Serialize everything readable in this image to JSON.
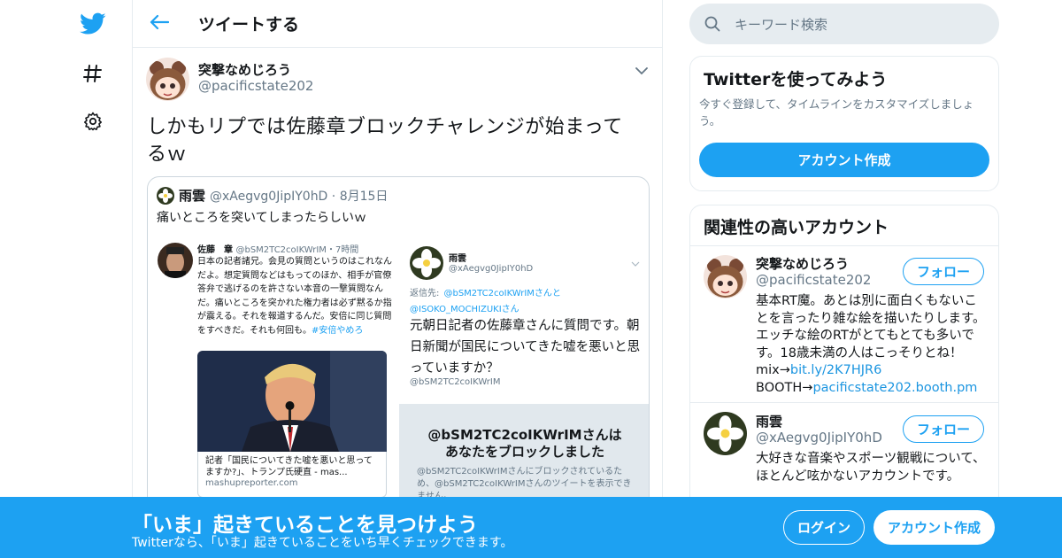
{
  "icons": {
    "logo": "twitter-bird-icon",
    "explore": "hashtag-icon",
    "settings": "gear-icon",
    "back": "back-arrow-icon",
    "caret": "chevron-down-icon",
    "search": "search-icon"
  },
  "colors": {
    "accent": "#1da1f2",
    "link": "#1b95e0",
    "muted": "#657786"
  },
  "header": {
    "title": "ツイートする"
  },
  "tweet": {
    "author_name": "突撃なめじろう",
    "author_handle": "@pacificstate202",
    "text": "しかもリプでは佐藤章ブロックチャレンジが始まってるｗ",
    "quote": {
      "author_name": "雨雲",
      "author_handle": "@xAegvg0JipIY0hD",
      "date": "8月15日",
      "text": "痛いところを突いてしまったらしいｗ",
      "image": {
        "left": {
          "name": "佐藤　章",
          "handle": "@bSM2TC2coIKWrIM",
          "time": "7時間",
          "body": "日本の記者諸兄。会見の質問というのはこれなんだよ。想定質問などはもってのほか、相手が官僚答弁で逃げるのを許さない本音の一撃質問なんだ。痛いところを突かれた権力者は必ず黙るか指が震える。それを報道するんだ。安倍に同じ質問をすべきだ。それも何回も。",
          "hashtag": "#安倍やめろ",
          "card_title": "記者「国民についてきた嘘を悪いと思ってますか?」、トランプ氏硬直 - mas...",
          "card_domain": "mashupreporter.com"
        },
        "right": {
          "name": "雨雲",
          "handle": "@xAegvg0JipIY0hD",
          "reply_prefix": "返信先:",
          "reply_to": "@bSM2TC2coIKWrIMさんと",
          "reply_to2": "@ISOKO_MOCHIZUKIさん",
          "body": "元朝日記者の佐藤章さんに質問です。朝日新聞が国民についてきた嘘を悪いと思っていますか？",
          "footer_handle": "@bSM2TC2coIKWrIM",
          "block_title_line1": "@bSM2TC2coIKWrIMさんは",
          "block_title_line2": "あなたをブロックしました",
          "block_sub": "@bSM2TC2coIKWrIMさんにブロックされているため、@bSM2TC2coIKWrIMさんのツイートを表示できません。"
        }
      }
    }
  },
  "search": {
    "placeholder": "キーワード検索"
  },
  "signup_card": {
    "title": "Twitterを使ってみよう",
    "desc": "今すぐ登録して、タイムラインをカスタマイズしましょう。",
    "button": "アカウント作成"
  },
  "related": {
    "title": "関連性の高いアカウント",
    "accounts": [
      {
        "name": "突撃なめじろう",
        "handle": "@pacificstate202",
        "follow": "フォロー",
        "bio": "基本RT魔。あとは別に面白くもないことを言ったり雑な絵を描いたりします。 エッチな絵のRTがとてもとても多いです。18歳未満の人はこっそりとね！ mix→",
        "bio_link": "bit.ly/2K7HJR6",
        "bio2": "BOOTH→",
        "bio2_link": "pacificstate202.booth.pm"
      },
      {
        "name": "雨雲",
        "handle": "@xAegvg0JipIY0hD",
        "follow": "フォロー",
        "bio": "大好きな音楽やスポーツ観戦について、ほとんど呟かないアカウントです。"
      }
    ]
  },
  "bottom_bar": {
    "title": "「いま」起きていることを見つけよう",
    "subtitle": "Twitterなら、「いま」起きていることをいち早くチェックできます。",
    "login": "ログイン",
    "signup": "アカウント作成"
  }
}
